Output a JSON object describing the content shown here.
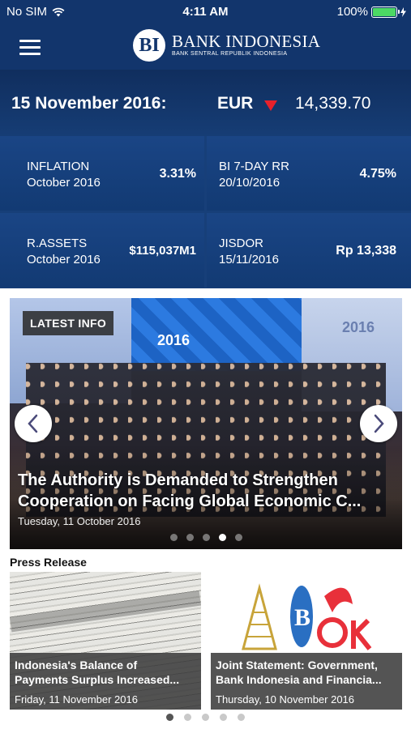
{
  "status_bar": {
    "carrier": "No SIM",
    "time": "4:11 AM",
    "battery": "100%"
  },
  "header": {
    "logo_mark": "BI",
    "title": "BANK INDONESIA",
    "subtitle": "BANK SENTRAL REPUBLIK INDONESIA"
  },
  "rate": {
    "date": "15 November 2016:",
    "currency": "EUR",
    "trend": "down",
    "value": "14,339.70"
  },
  "indicators": [
    {
      "label1": "INFLATION",
      "label2": "October 2016",
      "value": "3.31%"
    },
    {
      "label1": "BI 7-DAY RR",
      "label2": "20/10/2016",
      "value": "4.75%"
    },
    {
      "label1": "R.ASSETS",
      "label2": "October 2016",
      "value": "$115,037M1"
    },
    {
      "label1": "JISDOR",
      "label2": "15/11/2016",
      "value": "Rp 13,338"
    }
  ],
  "carousel": {
    "badge": "LATEST INFO",
    "title_line1": "The Authority is Demanded to Strengthen",
    "title_line2": "Cooperation on Facing Global Economic C...",
    "date": "Tuesday, 11 October 2016",
    "banner_year": "2016",
    "slide_count": 5,
    "active_index": 3
  },
  "press_release": {
    "section_title": "Press Release",
    "items": [
      {
        "title_line1": "Indonesia's Balance of",
        "title_line2": "Payments Surplus Increased...",
        "date": "Friday, 11 November 2016"
      },
      {
        "title_line1": "Joint Statement: Government,",
        "title_line2": "Bank Indonesia and Financia...",
        "date": "Thursday, 10 November 2016"
      }
    ],
    "page_count": 5,
    "active_index": 0
  },
  "colors": {
    "brand_navy": "#12356c",
    "down_arrow": "#e8212b",
    "battery_green": "#4cd964"
  }
}
